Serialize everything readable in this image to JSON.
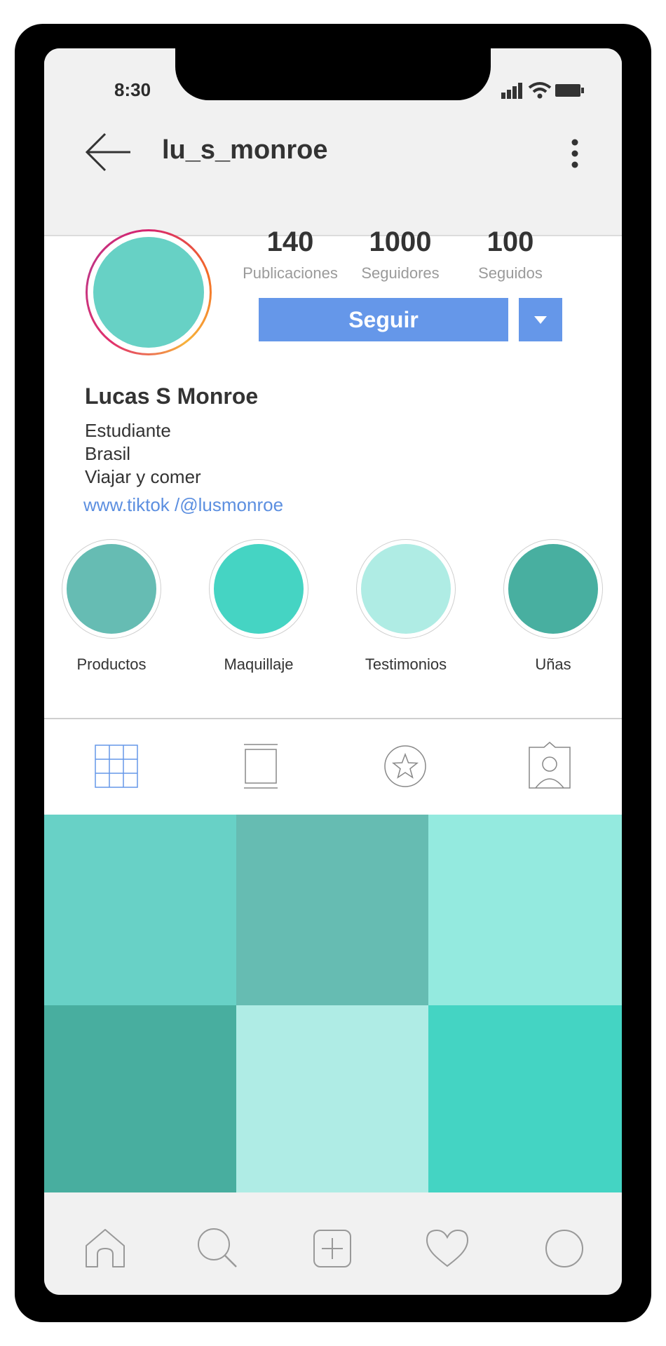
{
  "status_bar": {
    "time": "8:30"
  },
  "header": {
    "username": "lu_s_monroe"
  },
  "stats": [
    {
      "number": "140",
      "label": "Publicaciones"
    },
    {
      "number": "1000",
      "label": "Seguidores"
    },
    {
      "number": "100",
      "label": "Seguidos"
    }
  ],
  "actions": {
    "follow_label": "Seguir"
  },
  "profile": {
    "name": "Lucas S Monroe",
    "bio_line1": "Estudiante",
    "bio_line2": "Brasil",
    "bio_line3": "Viajar y comer",
    "link": "www.tiktok /@lusmonroe",
    "avatar_color": "#67d1c5"
  },
  "highlights": [
    {
      "label": "Productos",
      "color": "#66bcb3"
    },
    {
      "label": "Maquillaje",
      "color": "#45d4c3"
    },
    {
      "label": "Testimonios",
      "color": "#afece4"
    },
    {
      "label": "Uñas",
      "color": "#48afa0"
    }
  ],
  "tabs": [
    {
      "icon": "grid-icon",
      "active": true
    },
    {
      "icon": "feed-icon",
      "active": false
    },
    {
      "icon": "star-icon",
      "active": false
    },
    {
      "icon": "tagged-icon",
      "active": false
    }
  ],
  "posts": [
    {
      "color": "#68d1c6"
    },
    {
      "color": "#66bcb2"
    },
    {
      "color": "#94eadf"
    },
    {
      "color": "#48ae9f"
    },
    {
      "color": "#afece5"
    },
    {
      "color": "#44d4c3"
    }
  ],
  "bottom_nav": [
    "home-icon",
    "search-icon",
    "add-icon",
    "heart-icon",
    "profile-icon"
  ],
  "colors": {
    "accent": "#6597e9",
    "link": "#5c8fe0"
  }
}
